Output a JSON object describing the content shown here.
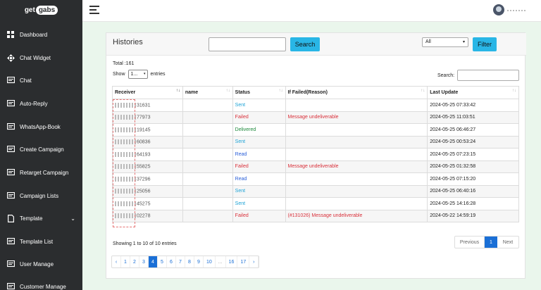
{
  "brand": {
    "text_left": "get",
    "text_pill": "gabs"
  },
  "sidebar": {
    "items": [
      {
        "label": "Dashboard",
        "icon": "dashboard-icon"
      },
      {
        "label": "Chat Widget",
        "icon": "move-icon"
      },
      {
        "label": "Chat",
        "icon": "chat-icon"
      },
      {
        "label": "Auto-Reply",
        "icon": "chat-icon"
      },
      {
        "label": "WhatsApp-Book",
        "icon": "chat-icon"
      },
      {
        "label": "Create Campaign",
        "icon": "chat-icon"
      },
      {
        "label": "Retarget Campaign",
        "icon": "chat-icon"
      },
      {
        "label": "Campaign Lists",
        "icon": "chat-icon"
      },
      {
        "label": "Template",
        "icon": "file-icon",
        "chevron": "⌄"
      },
      {
        "label": "Template List",
        "icon": "chat-icon"
      },
      {
        "label": "User Manage",
        "icon": "chat-icon"
      },
      {
        "label": "Customer Manage",
        "icon": "chat-icon"
      }
    ]
  },
  "header": {
    "title": "Histories",
    "search_button": "Search",
    "filter_select": "All",
    "filter_button": "Filter"
  },
  "list": {
    "total": "Total :161",
    "show_label": "Show",
    "show_value": "1...",
    "entries_label": "entries",
    "search_label": "Search:"
  },
  "table": {
    "columns": [
      "Receiver",
      "name",
      "Status",
      "If Failed(Reason)",
      "Last Update"
    ],
    "rows": [
      {
        "receiver": "31631",
        "name": "",
        "status": "Sent",
        "status_class": "st-sent",
        "reason": "",
        "updated": "2024-05-25 07:33:42"
      },
      {
        "receiver": "77973",
        "name": "",
        "status": "Failed",
        "status_class": "st-failed",
        "reason": "Message undeliverable",
        "updated": "2024-05-25 11:03:51"
      },
      {
        "receiver": "19145",
        "name": "",
        "status": "Delivered",
        "status_class": "st-delivered",
        "reason": "",
        "updated": "2024-05-25 06:46:27"
      },
      {
        "receiver": "60836",
        "name": "",
        "status": "Sent",
        "status_class": "st-sent",
        "reason": "",
        "updated": "2024-05-25 00:53:24"
      },
      {
        "receiver": "64193",
        "name": "",
        "status": "Read",
        "status_class": "st-read",
        "reason": "",
        "updated": "2024-05-25 07:23:15"
      },
      {
        "receiver": "55825",
        "name": "",
        "status": "Failed",
        "status_class": "st-failed",
        "reason": "Message undeliverable",
        "updated": "2024-05-25 01:32:58"
      },
      {
        "receiver": "37296",
        "name": "",
        "status": "Read",
        "status_class": "st-read",
        "reason": "",
        "updated": "2024-05-25 07:15:20"
      },
      {
        "receiver": "25056",
        "name": "",
        "status": "Sent",
        "status_class": "st-sent",
        "reason": "",
        "updated": "2024-05-25 06:40:16"
      },
      {
        "receiver": "45275",
        "name": "",
        "status": "Sent",
        "status_class": "st-sent",
        "reason": "",
        "updated": "2024-05-25 14:16:28"
      },
      {
        "receiver": "02278",
        "name": "",
        "status": "Failed",
        "status_class": "st-failed",
        "reason": "(#131026) Message undeliverable",
        "updated": "2024-05-22 14:59:19"
      }
    ]
  },
  "footer": {
    "showing": "Showing 1 to 10 of 10 entries",
    "previous": "Previous",
    "current": "1",
    "next": "Next"
  },
  "pagination": {
    "items": [
      "‹",
      "1",
      "2",
      "3",
      "4",
      "5",
      "6",
      "7",
      "8",
      "9",
      "10",
      "...",
      "16",
      "17",
      "›"
    ],
    "active": "4"
  },
  "colors": {
    "sidebar": "#2b2d2f",
    "background": "#eaf6ec",
    "accent": "#29b6e6",
    "active_page": "#1a6fd6"
  }
}
